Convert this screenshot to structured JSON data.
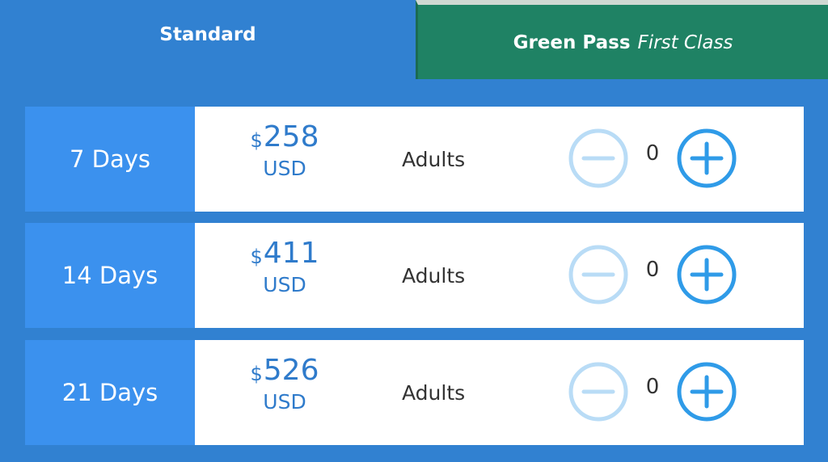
{
  "tabs": {
    "standard": {
      "label": "Standard"
    },
    "green_pass": {
      "label_strong": "Green Pass",
      "label_italic": "First Class"
    }
  },
  "colors": {
    "page_background": "#3181d1",
    "duration_cell": "#3b91ee",
    "green_tab": "#1f8264",
    "price_text": "#2f7bcb",
    "minus_disabled": "#b9dcf6",
    "plus_active": "#2f9be8"
  },
  "passes": [
    {
      "duration": "7 Days",
      "currency_symbol": "$",
      "amount": "258",
      "currency_code": "USD",
      "category": "Adults",
      "quantity": "0",
      "minus_icon": "minus-circle-icon",
      "plus_icon": "plus-circle-icon"
    },
    {
      "duration": "14 Days",
      "currency_symbol": "$",
      "amount": "411",
      "currency_code": "USD",
      "category": "Adults",
      "quantity": "0",
      "minus_icon": "minus-circle-icon",
      "plus_icon": "plus-circle-icon"
    },
    {
      "duration": "21 Days",
      "currency_symbol": "$",
      "amount": "526",
      "currency_code": "USD",
      "category": "Adults",
      "quantity": "0",
      "minus_icon": "minus-circle-icon",
      "plus_icon": "plus-circle-icon"
    }
  ]
}
